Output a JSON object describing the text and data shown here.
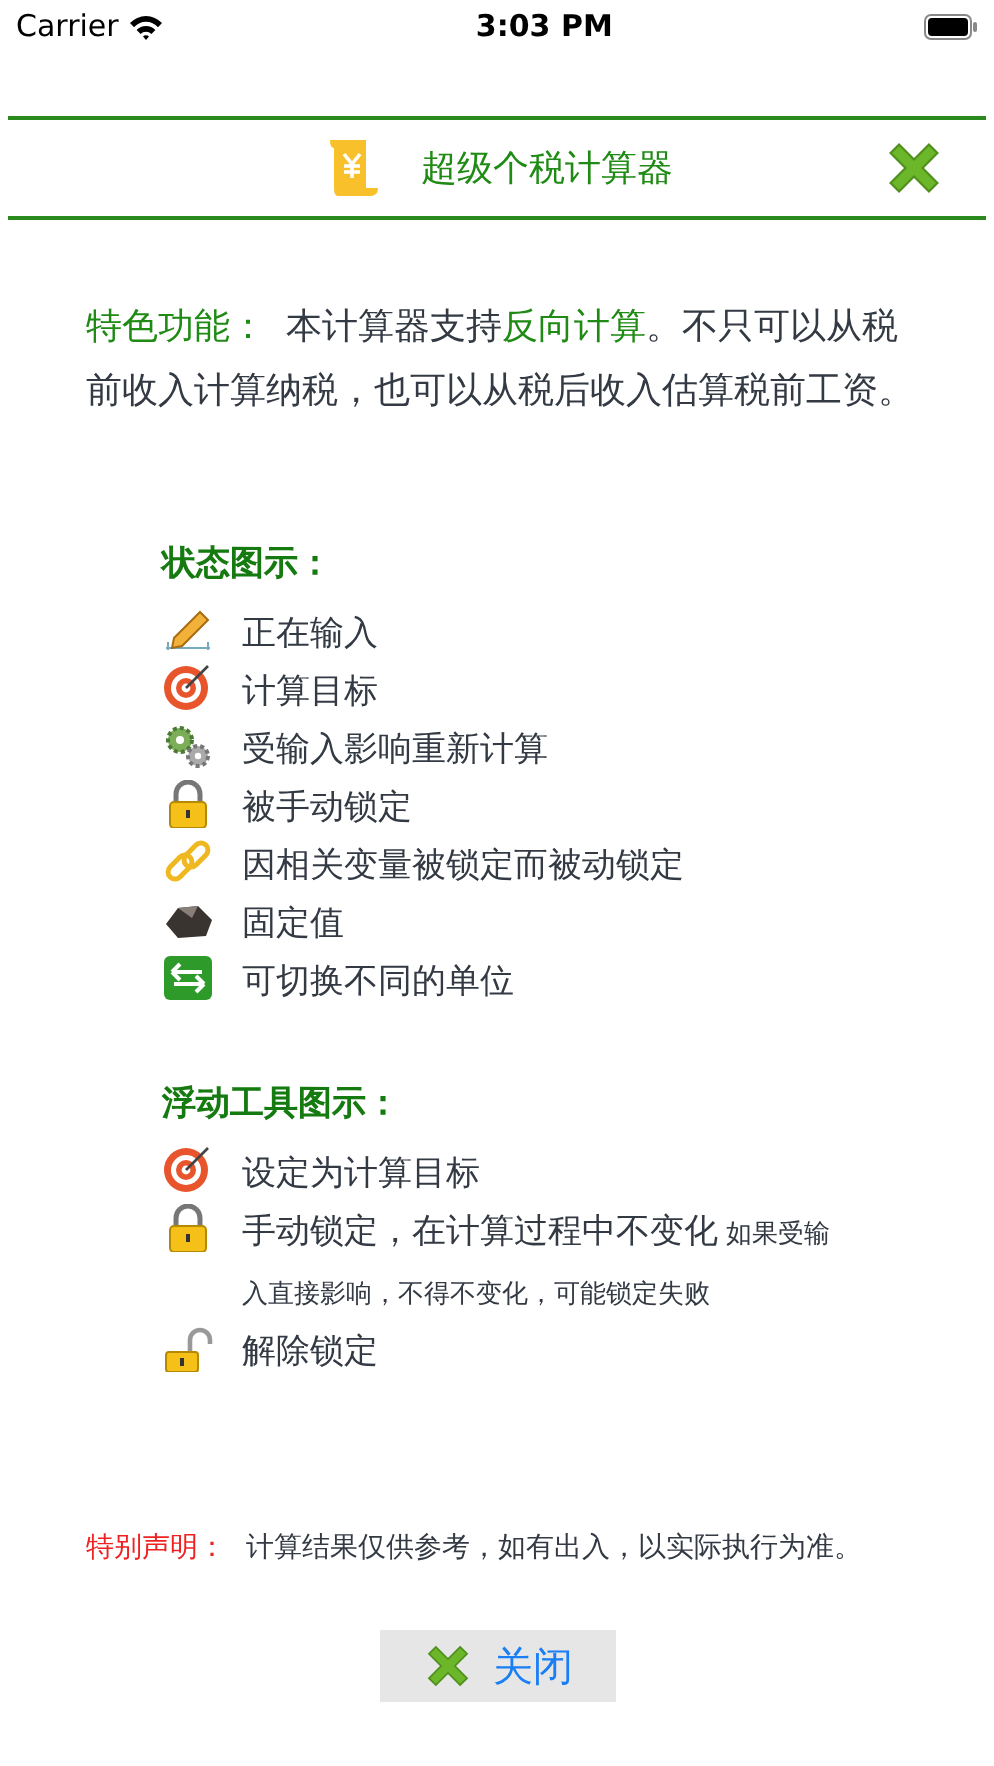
{
  "status_bar": {
    "carrier": "Carrier",
    "time": "3:03 PM"
  },
  "header": {
    "title": "超级个税计算器"
  },
  "intro": [
    {
      "kind": "label",
      "text": "特色功能："
    },
    {
      "kind": "plain",
      "text": "本计算器支持"
    },
    {
      "kind": "highlight",
      "text": "反向计算"
    },
    {
      "kind": "plain",
      "text": "。不只可以从税前收入计算纳税，也可以从税后收入估算税前工资。"
    }
  ],
  "status_legend": {
    "title": "状态图示：",
    "items": [
      {
        "kind": "pencil",
        "text": "正在输入"
      },
      {
        "kind": "target",
        "text": "计算目标"
      },
      {
        "kind": "gears",
        "text": "受输入影响重新计算"
      },
      {
        "kind": "lock",
        "text": "被手动锁定"
      },
      {
        "kind": "chain",
        "text": "因相关变量被锁定而被动锁定"
      },
      {
        "kind": "rock",
        "text": "固定值"
      },
      {
        "kind": "switch",
        "text": "可切换不同的单位"
      }
    ]
  },
  "tool_legend": {
    "title": "浮动工具图示：",
    "items": [
      {
        "kind": "target",
        "text": "设定为计算目标"
      },
      {
        "kind": "lock",
        "text": "手动锁定，在计算过程中不变化",
        "note": "如果受输入直接影响，不得不变化，可能锁定失败"
      },
      {
        "kind": "unlock",
        "text": "解除锁定"
      }
    ]
  },
  "disclaimer": {
    "label": "特别声明：",
    "text": "计算结果仅供参考，如有出入，以实际执行为准。"
  },
  "close_button": {
    "label": "关闭"
  }
}
